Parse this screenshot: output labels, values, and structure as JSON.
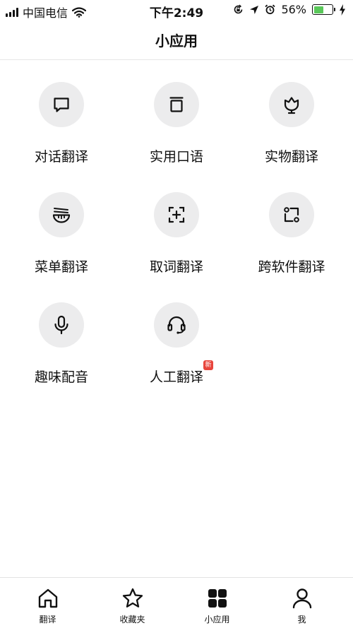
{
  "status_bar": {
    "carrier": "中国电信",
    "time": "下午2:49",
    "battery_percent": "56%",
    "battery_level": 0.56,
    "battery_color": "#5ac85a",
    "icons": [
      "signal-icon",
      "wifi-icon",
      "orientation-lock-icon",
      "location-icon",
      "alarm-icon",
      "battery-icon",
      "charging-icon"
    ]
  },
  "header": {
    "title": "小应用"
  },
  "apps": [
    {
      "label": "对话翻译",
      "icon": "chat-bubble-icon"
    },
    {
      "label": "实用口语",
      "icon": "card-stack-icon"
    },
    {
      "label": "实物翻译",
      "icon": "flower-icon"
    },
    {
      "label": "菜单翻译",
      "icon": "noodle-bowl-icon"
    },
    {
      "label": "取词翻译",
      "icon": "scan-plus-icon"
    },
    {
      "label": "跨软件翻译",
      "icon": "cross-app-icon"
    },
    {
      "label": "趣味配音",
      "icon": "microphone-icon"
    },
    {
      "label": "人工翻译",
      "icon": "headset-icon",
      "badge": "新"
    }
  ],
  "tab_bar": {
    "active": "小应用",
    "tabs": [
      {
        "label": "翻译",
        "icon": "home-icon"
      },
      {
        "label": "收藏夹",
        "icon": "star-icon"
      },
      {
        "label": "小应用",
        "icon": "apps-grid-icon"
      },
      {
        "label": "我",
        "icon": "person-icon"
      }
    ]
  },
  "colors": {
    "accent_badge": "#e8453c",
    "icon_circle": "#ececed",
    "text": "#111111"
  }
}
